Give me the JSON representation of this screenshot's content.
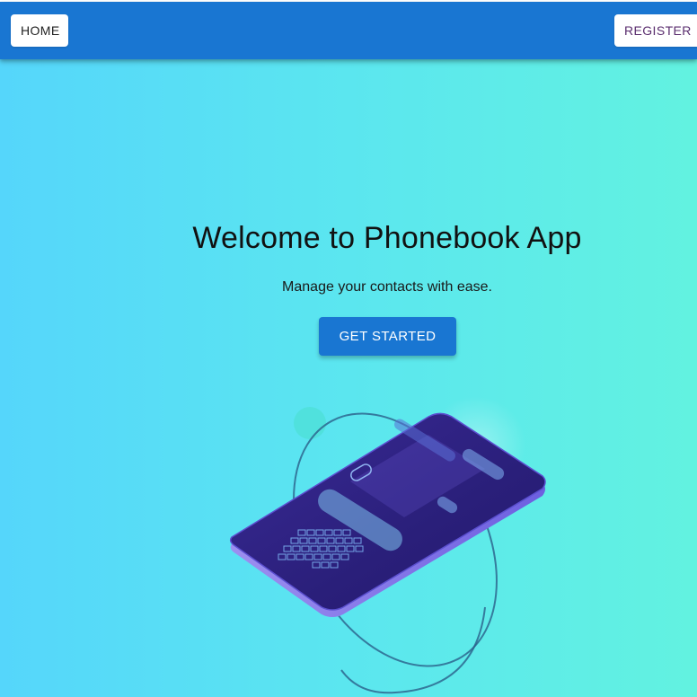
{
  "navbar": {
    "home_label": "HOME",
    "register_label": "REGISTER"
  },
  "hero": {
    "title": "Welcome to Phonebook App",
    "subtitle": "Manage your contacts with ease.",
    "cta_label": "GET STARTED"
  },
  "colors": {
    "navbar": "#1976d2",
    "cta": "#1976d2",
    "background_start": "#55d6fb",
    "background_end": "#62f2e0"
  },
  "illustration": {
    "icon": "smartphone-illustration"
  }
}
